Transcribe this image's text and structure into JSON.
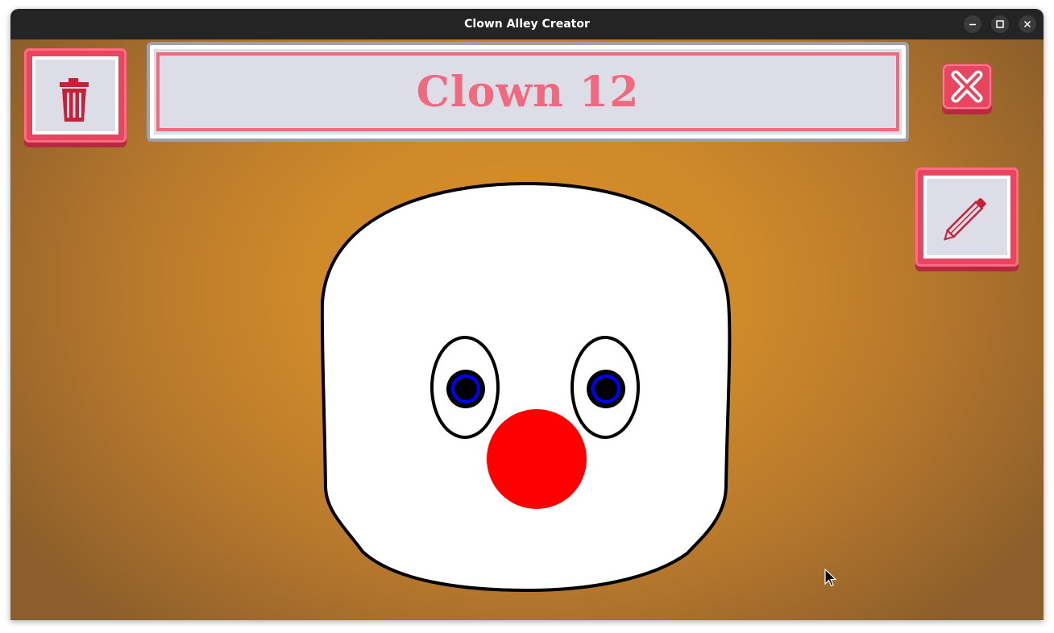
{
  "window": {
    "title": "Clown Alley Creator",
    "controls": [
      "minimize",
      "maximize",
      "close"
    ]
  },
  "toolbar": {
    "delete_icon": "trash-icon",
    "close_icon": "close-x-icon",
    "edit_icon": "pencil-icon"
  },
  "clown": {
    "name": "Clown 12",
    "face_color": "#ffffff",
    "nose_color": "#ff0000",
    "iris_color": "#0000ff",
    "pupil_color": "#000000"
  },
  "colors": {
    "accent": "#e84560",
    "accent_light": "#f0697e",
    "panel": "#dcdde6",
    "background": "#d98d24"
  }
}
